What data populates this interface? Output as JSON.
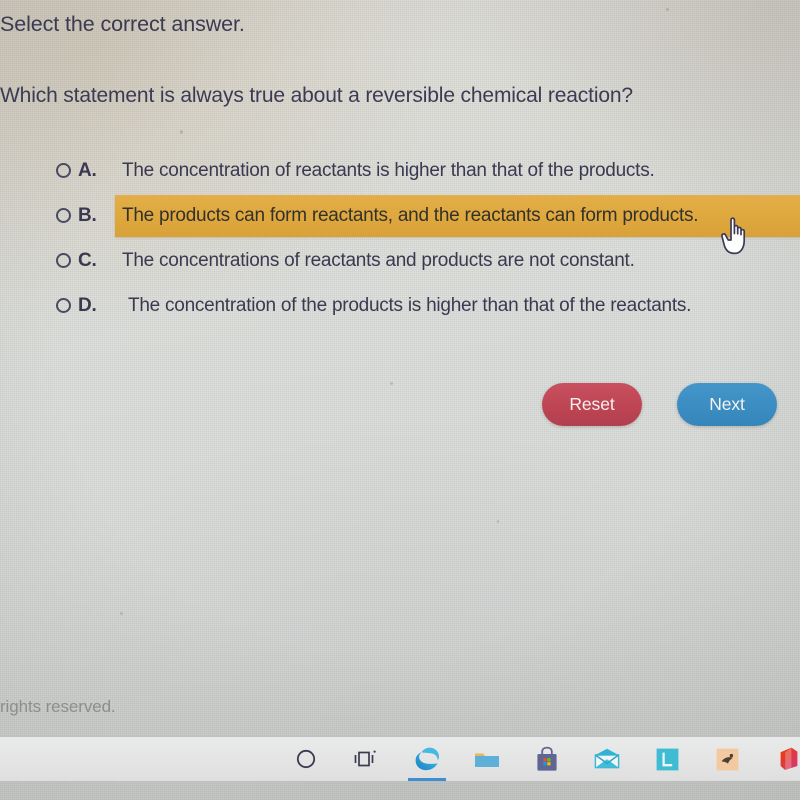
{
  "prompt": "Select the correct answer.",
  "question": "Which statement is always true about a reversible chemical reaction?",
  "options": [
    {
      "letter": "A.",
      "text": "The concentration of reactants is higher than that of the products.",
      "selected": false,
      "highlighted": false
    },
    {
      "letter": "B.",
      "text": "The products can form reactants, and the reactants can form products.",
      "selected": false,
      "highlighted": true
    },
    {
      "letter": "C.",
      "text": "The concentrations of reactants and products are not constant.",
      "selected": false,
      "highlighted": false
    },
    {
      "letter": "D.",
      "text": "The concentration of the products is higher than that of the reactants.",
      "selected": false,
      "highlighted": false
    }
  ],
  "buttons": {
    "reset_label": "Reset",
    "next_label": "Next"
  },
  "footer": {
    "copyright": "rights reserved."
  },
  "taskbar": {
    "items": [
      {
        "name": "cortana-circle-icon"
      },
      {
        "name": "task-view-icon"
      },
      {
        "name": "microsoft-edge-icon",
        "active": true
      },
      {
        "name": "file-explorer-icon"
      },
      {
        "name": "microsoft-store-icon"
      },
      {
        "name": "mail-icon"
      },
      {
        "name": "l-app-icon"
      },
      {
        "name": "peach-app-icon"
      },
      {
        "name": "microsoft-office-icon"
      }
    ]
  },
  "cursor": {
    "type": "pointing-hand"
  },
  "colors": {
    "highlight": "#dfa93f",
    "reset_button": "#be4554",
    "next_button": "#3b8dc2",
    "text": "#3a3950",
    "page_background": "#dfe1dd",
    "taskbar": "#e4e5e4"
  }
}
